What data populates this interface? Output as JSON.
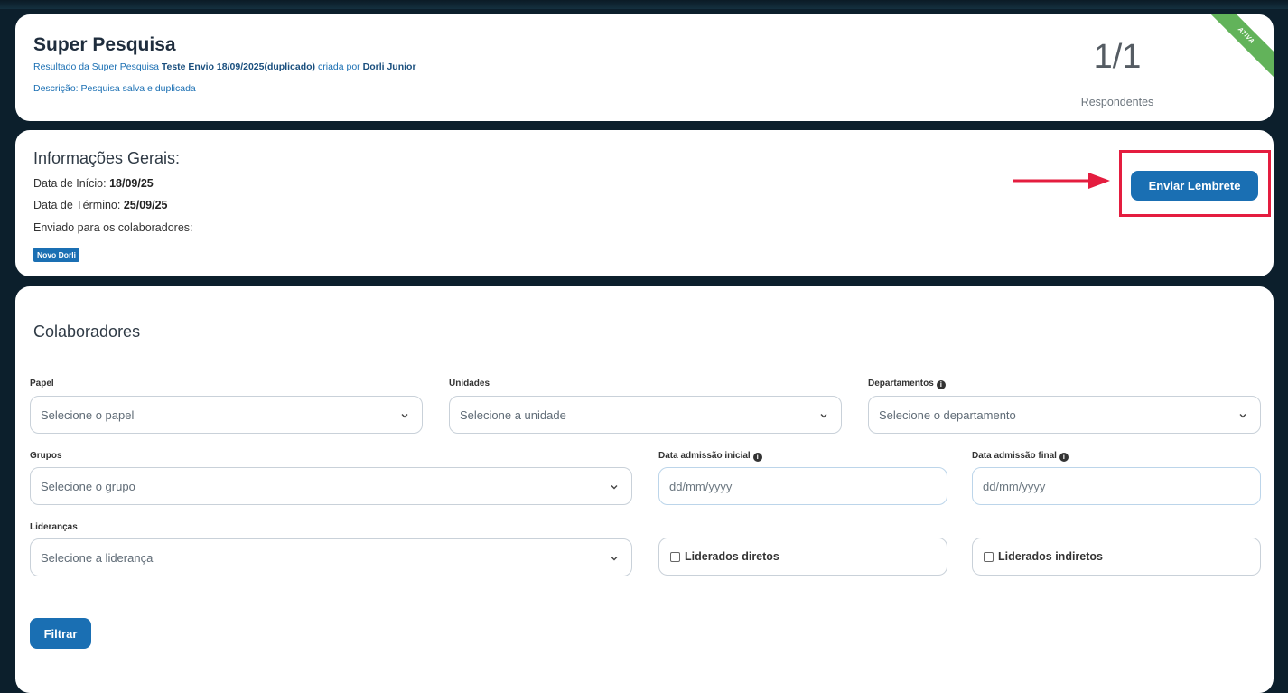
{
  "header": {
    "title": "Super Pesquisa",
    "subtitle_prefix": "Resultado da Super Pesquisa",
    "survey_name": "Teste Envio 18/09/2025(duplicado)",
    "created_by_text": "criada por",
    "author": "Dorli Junior",
    "description": "Descrição: Pesquisa salva e duplicada",
    "respondents_count": "1/1",
    "respondents_label": "Respondentes",
    "status_ribbon": "ATIVA"
  },
  "info": {
    "title": "Informações Gerais:",
    "start_label": "Data de Início:",
    "start_date": "18/09/25",
    "end_label": "Data de Término:",
    "end_date": "25/09/25",
    "sent_to_label": "Enviado para os colaboradores:",
    "recipient_tag": "Novo Dorli",
    "reminder_button": "Enviar Lembrete"
  },
  "collaborators": {
    "title": "Colaboradores",
    "filters": {
      "papel": {
        "label": "Papel",
        "placeholder": "Selecione o papel"
      },
      "unidades": {
        "label": "Unidades",
        "placeholder": "Selecione a unidade"
      },
      "departamentos": {
        "label": "Departamentos",
        "placeholder": "Selecione o departamento"
      },
      "grupos": {
        "label": "Grupos",
        "placeholder": "Selecione o grupo"
      },
      "admissao_inicial": {
        "label": "Data admissão inicial",
        "placeholder": "dd/mm/yyyy"
      },
      "admissao_final": {
        "label": "Data admissão final",
        "placeholder": "dd/mm/yyyy"
      },
      "liderancas": {
        "label": "Lideranças",
        "placeholder": "Selecione a liderança"
      },
      "liderados_diretos": {
        "label": "Liderados diretos"
      },
      "liderados_indiretos": {
        "label": "Liderados indiretos"
      }
    },
    "filter_button": "Filtrar"
  },
  "colors": {
    "primary": "#1a6fb3",
    "background": "#0c1f2c",
    "highlight": "#e41d3f",
    "ribbon": "#62b35a"
  }
}
